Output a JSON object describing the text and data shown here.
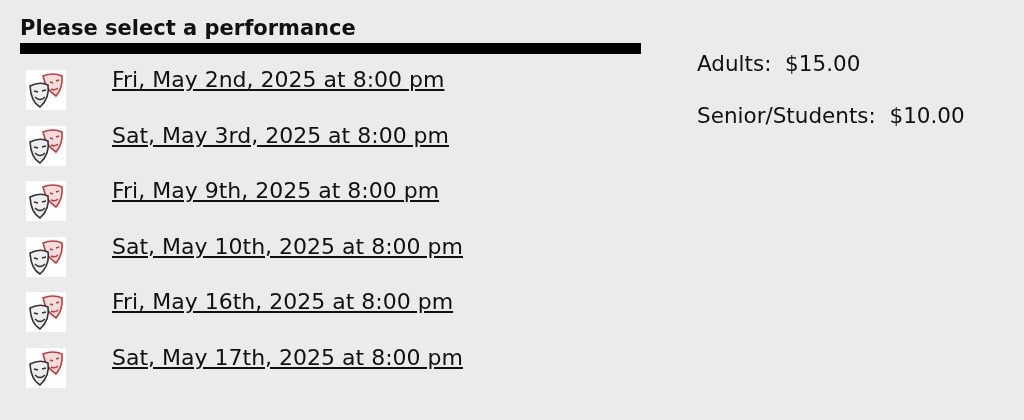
{
  "heading": "Please select a performance",
  "performances": [
    {
      "label": "Fri, May 2nd, 2025 at 8:00 pm"
    },
    {
      "label": "Sat, May 3rd, 2025 at 8:00 pm"
    },
    {
      "label": "Fri, May 9th, 2025 at 8:00 pm"
    },
    {
      "label": "Sat, May 10th, 2025 at 8:00 pm"
    },
    {
      "label": "Fri, May 16th, 2025 at 8:00 pm"
    },
    {
      "label": "Sat, May 17th, 2025 at 8:00 pm"
    }
  ],
  "prices": [
    "Adults:  $15.00",
    "Senior/Students:  $10.00"
  ]
}
